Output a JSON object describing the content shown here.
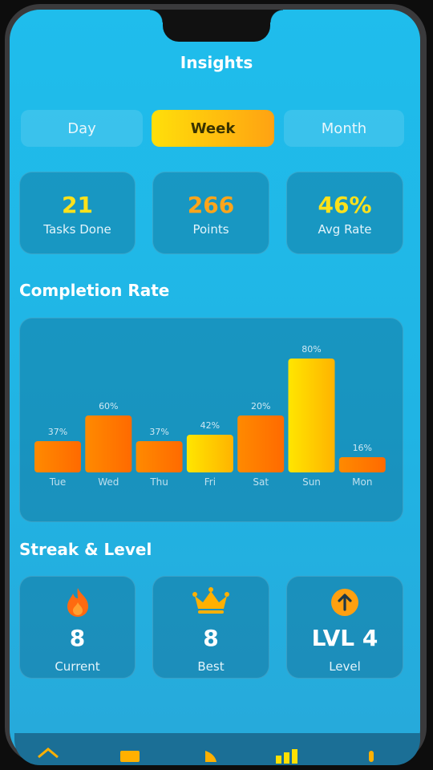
{
  "header": {
    "title": "Insights"
  },
  "segments": [
    {
      "label": "Day",
      "active": false
    },
    {
      "label": "Week",
      "active": true
    },
    {
      "label": "Month",
      "active": false
    }
  ],
  "stats": [
    {
      "value": "21",
      "label": "Tasks Done",
      "color": "#ffe21a"
    },
    {
      "value": "266",
      "label": "Points",
      "color": "#ffa51a"
    },
    {
      "value": "46%",
      "label": "Avg Rate",
      "color": "#ffe21a"
    }
  ],
  "completion": {
    "title": "Completion Rate"
  },
  "chart_data": {
    "type": "bar",
    "categories": [
      "Tue",
      "Wed",
      "Thu",
      "Fri",
      "Sat",
      "Sun",
      "Mon"
    ],
    "values": [
      37,
      60,
      37,
      42,
      20,
      80,
      16
    ],
    "data_labels": [
      "37%",
      "60%",
      "37%",
      "42%",
      "20%",
      "80%",
      "16%"
    ],
    "title": "",
    "xlabel": "",
    "ylabel": "",
    "ylim": [
      0,
      100
    ],
    "grid": false,
    "colors": {
      "orange": "#ff7a00",
      "yellow": "#ffe000"
    }
  },
  "streak": {
    "title": "Streak & Level",
    "cards": [
      {
        "value": "8",
        "label": "Current",
        "icon": "flame-icon"
      },
      {
        "value": "8",
        "label": "Best",
        "icon": "crown-icon"
      },
      {
        "value": "LVL 4",
        "label": "Level",
        "icon": "arrow-up-circle-icon"
      }
    ]
  },
  "nav": {
    "icons": [
      "home-icon",
      "tasks-icon",
      "rewards-icon",
      "insights-icon",
      "profile-icon"
    ]
  }
}
